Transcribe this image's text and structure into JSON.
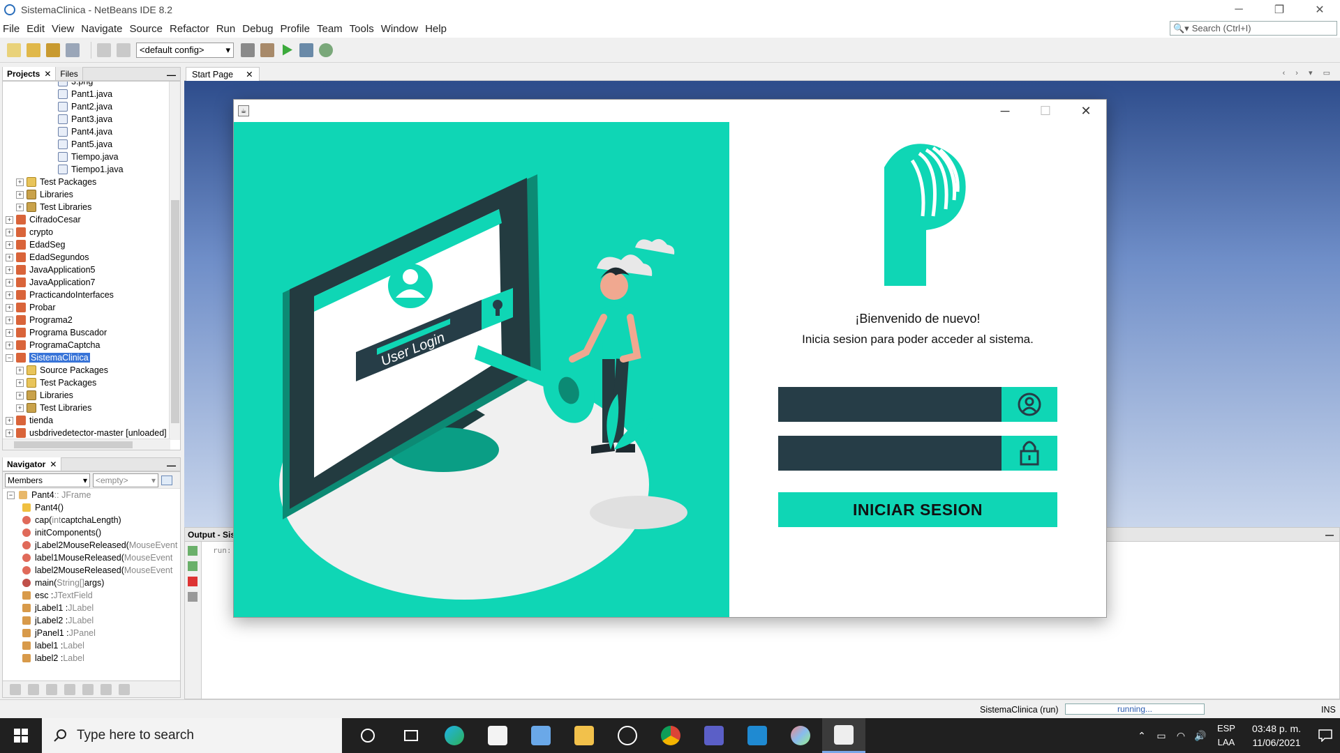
{
  "window": {
    "title": "SistemaClinica - NetBeans IDE 8.2",
    "controls": [
      "─",
      "❐",
      "✕"
    ]
  },
  "menu": [
    "File",
    "Edit",
    "View",
    "Navigate",
    "Source",
    "Refactor",
    "Run",
    "Debug",
    "Profile",
    "Team",
    "Tools",
    "Window",
    "Help"
  ],
  "search": {
    "placeholder": "Search (Ctrl+I)"
  },
  "toolbar": {
    "config": "<default config>"
  },
  "projects_panel": {
    "tabs": [
      "Projects",
      "Files"
    ],
    "rows": [
      {
        "label": "3.png",
        "level": 4,
        "icon": "image-file-icon",
        "partial": true
      },
      {
        "label": "Pant1.java",
        "level": 4,
        "icon": "java-file-icon"
      },
      {
        "label": "Pant2.java",
        "level": 4,
        "icon": "java-file-icon"
      },
      {
        "label": "Pant3.java",
        "level": 4,
        "icon": "java-file-icon"
      },
      {
        "label": "Pant4.java",
        "level": 4,
        "icon": "java-file-icon"
      },
      {
        "label": "Pant5.java",
        "level": 4,
        "icon": "java-file-icon"
      },
      {
        "label": "Tiempo.java",
        "level": 4,
        "icon": "java-file-icon"
      },
      {
        "label": "Tiempo1.java",
        "level": 4,
        "icon": "java-file-icon"
      },
      {
        "label": "Test Packages",
        "level": 1,
        "icon": "folder-icon",
        "expand": true
      },
      {
        "label": "Libraries",
        "level": 1,
        "icon": "library-icon",
        "expand": true
      },
      {
        "label": "Test Libraries",
        "level": 1,
        "icon": "library-icon",
        "expand": true
      },
      {
        "label": "CifradoCesar",
        "level": 0,
        "icon": "project-icon",
        "expand": true
      },
      {
        "label": "crypto",
        "level": 0,
        "icon": "project-icon",
        "expand": true
      },
      {
        "label": "EdadSeg",
        "level": 0,
        "icon": "project-icon",
        "expand": true
      },
      {
        "label": "EdadSegundos",
        "level": 0,
        "icon": "project-icon",
        "expand": true
      },
      {
        "label": "JavaApplication5",
        "level": 0,
        "icon": "project-icon",
        "expand": true
      },
      {
        "label": "JavaApplication7",
        "level": 0,
        "icon": "project-icon",
        "expand": true
      },
      {
        "label": "PracticandoInterfaces",
        "level": 0,
        "icon": "project-icon",
        "expand": true
      },
      {
        "label": "Probar",
        "level": 0,
        "icon": "project-icon",
        "expand": true
      },
      {
        "label": "Programa2",
        "level": 0,
        "icon": "project-icon",
        "expand": true
      },
      {
        "label": "Programa Buscador",
        "level": 0,
        "icon": "project-icon",
        "expand": true
      },
      {
        "label": "ProgramaCaptcha",
        "level": 0,
        "icon": "project-icon",
        "expand": true
      },
      {
        "label": "SistemaClinica",
        "level": 0,
        "icon": "project-icon",
        "expand": true,
        "selected": true,
        "expanded": true
      },
      {
        "label": "Source Packages",
        "level": 1,
        "icon": "folder-icon",
        "expand": true
      },
      {
        "label": "Test Packages",
        "level": 1,
        "icon": "folder-icon",
        "expand": true
      },
      {
        "label": "Libraries",
        "level": 1,
        "icon": "library-icon",
        "expand": true
      },
      {
        "label": "Test Libraries",
        "level": 1,
        "icon": "library-icon",
        "expand": true
      },
      {
        "label": "tienda",
        "level": 0,
        "icon": "project-icon",
        "expand": true
      },
      {
        "label": "usbdrivedetector-master [unloaded]",
        "level": 0,
        "icon": "project-icon",
        "expand": true
      }
    ]
  },
  "navigator": {
    "tab": "Navigator",
    "filter": "Members",
    "empty": "<empty>",
    "rows": [
      {
        "name": "Pant4",
        "type": " :: JFrame",
        "level": 0,
        "icon": "class-icon"
      },
      {
        "name": "Pant4()",
        "type": "",
        "level": 1,
        "icon": "constructor-icon"
      },
      {
        "name": "cap(",
        "type": "int",
        "extra": " captchaLength)",
        "level": 1,
        "icon": "method-icon"
      },
      {
        "name": "initComponents()",
        "type": "",
        "level": 1,
        "icon": "method-icon"
      },
      {
        "name": "jLabel2MouseReleased(",
        "type": "MouseEvent",
        "level": 1,
        "icon": "method-icon"
      },
      {
        "name": "label1MouseReleased(",
        "type": "MouseEvent",
        "level": 1,
        "icon": "method-icon"
      },
      {
        "name": "label2MouseReleased(",
        "type": "MouseEvent",
        "level": 1,
        "icon": "method-icon"
      },
      {
        "name": "main(",
        "type": "String[]",
        "extra": " args)",
        "level": 1,
        "icon": "static-method-icon"
      },
      {
        "name": "esc : ",
        "type": "JTextField",
        "level": 1,
        "icon": "field-icon"
      },
      {
        "name": "jLabel1 : ",
        "type": "JLabel",
        "level": 1,
        "icon": "field-icon"
      },
      {
        "name": "jLabel2 : ",
        "type": "JLabel",
        "level": 1,
        "icon": "field-icon"
      },
      {
        "name": "jPanel1 : ",
        "type": "JPanel",
        "level": 1,
        "icon": "field-icon"
      },
      {
        "name": "label1 : ",
        "type": "Label",
        "level": 1,
        "icon": "field-icon"
      },
      {
        "name": "label2 : ",
        "type": "Label",
        "level": 1,
        "icon": "field-icon"
      }
    ]
  },
  "editor": {
    "tab": "Start Page"
  },
  "output": {
    "title": "Output - Sist",
    "text": "run:"
  },
  "status": {
    "project": "SistemaClinica (run)",
    "progress_text": "running...",
    "mode": "INS"
  },
  "login": {
    "welcome": "¡Bienvenido de nuevo!",
    "subtitle": "Inicia sesion para poder acceder al sistema.",
    "username_icon": "user-circle-icon",
    "password_icon": "padlock-icon",
    "button": "INICIAR SESION",
    "illustration_text": "User Login",
    "accent": "#0fd6b5",
    "field_bg": "#263d47"
  },
  "taskbar": {
    "search_placeholder": "Type here to search",
    "apps": [
      "cortana-icon",
      "task-view-icon",
      "edge-icon",
      "store-icon",
      "3d-viewer-icon",
      "file-explorer-icon",
      "bitcoin-icon",
      "chrome-icon",
      "teams-icon",
      "vscode-icon",
      "paint-icon",
      "java-icon"
    ],
    "lang_top": "ESP",
    "lang_bottom": "LAA",
    "time": "03:48 p. m.",
    "date": "11/06/2021"
  }
}
